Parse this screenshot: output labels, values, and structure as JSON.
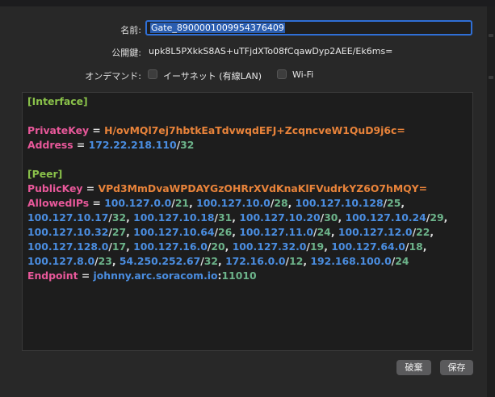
{
  "form": {
    "name_label": "名前:",
    "name_value": "Gate_8900001009954376409",
    "pubkey_label": "公開鍵:",
    "pubkey_value": "upk8L5PXkkS8AS+uTFjdXTo08fCqawDyp2AEE/Ek6ms=",
    "ondemand_label": "オンデマンド:",
    "ethernet_label": "イーサネット (有線LAN)",
    "wifi_label": "Wi-Fi"
  },
  "config": {
    "interface_header": "[Interface]",
    "private_key_key": "PrivateKey",
    "private_key_value": "H/ovMQl7ej7hbtkEaTdvwqdEFJ+ZcqncveW1QuD9j6c=",
    "address_key": "Address",
    "address_ip": "172.22.218.110",
    "address_mask": "32",
    "peer_header": "[Peer]",
    "public_key_key": "PublicKey",
    "public_key_value": "VPd3MmDvaWPDAYGzOHRrXVdKnaKlFVudrkYZ6O7hMQY=",
    "allowed_ips_key": "AllowedIPs",
    "allowed_ips_lines": [
      [
        [
          "100.127.0.0",
          "21"
        ],
        [
          "100.127.10.0",
          "28"
        ],
        [
          "100.127.10.128",
          "25"
        ]
      ],
      [
        [
          "100.127.10.17",
          "32"
        ],
        [
          "100.127.10.18",
          "31"
        ],
        [
          "100.127.10.20",
          "30"
        ],
        [
          "100.127.10.24",
          "29"
        ]
      ],
      [
        [
          "100.127.10.32",
          "27"
        ],
        [
          "100.127.10.64",
          "26"
        ],
        [
          "100.127.11.0",
          "24"
        ],
        [
          "100.127.12.0",
          "22"
        ]
      ],
      [
        [
          "100.127.128.0",
          "17"
        ],
        [
          "100.127.16.0",
          "20"
        ],
        [
          "100.127.32.0",
          "19"
        ],
        [
          "100.127.64.0",
          "18"
        ]
      ],
      [
        [
          "100.127.8.0",
          "23"
        ],
        [
          "54.250.252.67",
          "32"
        ],
        [
          "172.16.0.0",
          "12"
        ],
        [
          "192.168.100.0",
          "24"
        ]
      ]
    ],
    "endpoint_key": "Endpoint",
    "endpoint_host": "johnny.arc.soracom.io",
    "endpoint_port": "11010"
  },
  "buttons": {
    "discard_label": "破棄",
    "save_label": "保存"
  }
}
